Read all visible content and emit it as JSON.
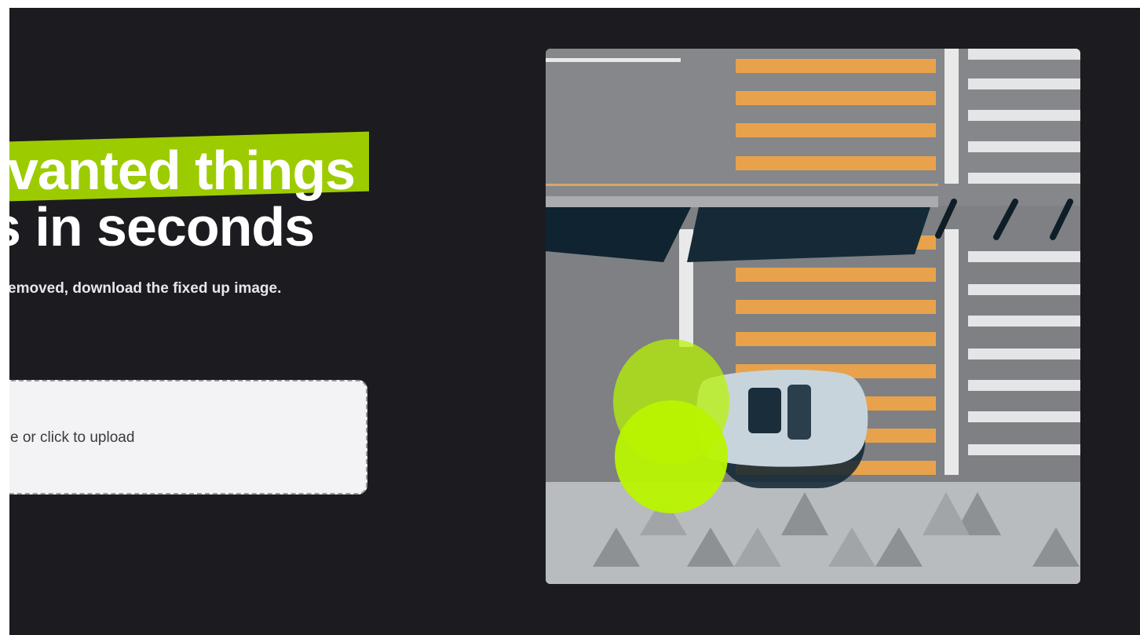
{
  "hero": {
    "title_line1": "vanted things",
    "title_line2": "s in seconds",
    "subtitle": "emoved, download the fixed up image."
  },
  "upload": {
    "label": "e or click to upload"
  },
  "demo": {
    "icon": "car-crosswalk-photo",
    "brush_color": "#b9f400",
    "highlight_color": "#9ccc00"
  }
}
